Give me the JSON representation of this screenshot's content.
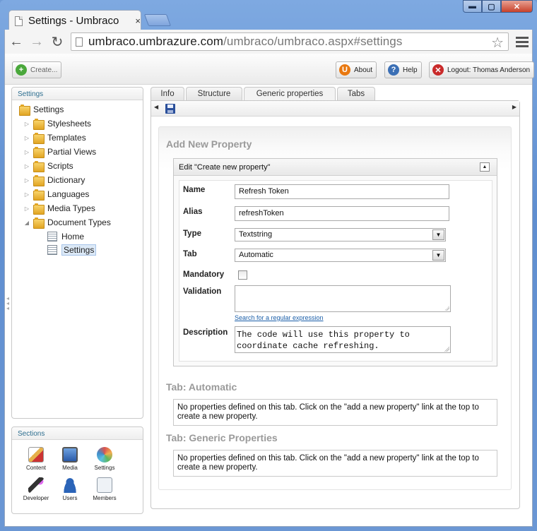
{
  "browser": {
    "tab_title": "Settings - Umbraco",
    "tab_close": "×",
    "url_host": "umbraco.umbrazure.com",
    "url_path": "/umbraco/umbraco.aspx#settings",
    "window_buttons": {
      "minimize": "▬",
      "maximize": "▢",
      "close": "✕"
    }
  },
  "toolbar": {
    "create_label": "Create...",
    "about_label": "About",
    "help_label": "Help",
    "logout_label": "Logout: Thomas Anderson"
  },
  "tree": {
    "title": "Settings",
    "root": "Settings",
    "items": [
      {
        "label": "Stylesheets"
      },
      {
        "label": "Templates"
      },
      {
        "label": "Partial Views"
      },
      {
        "label": "Scripts"
      },
      {
        "label": "Dictionary"
      },
      {
        "label": "Languages"
      },
      {
        "label": "Media Types"
      },
      {
        "label": "Document Types"
      }
    ],
    "children": [
      {
        "label": "Home"
      },
      {
        "label": "Settings"
      }
    ]
  },
  "sections": {
    "title": "Sections",
    "items": [
      {
        "label": "Content",
        "color": "#e6b04a"
      },
      {
        "label": "Media",
        "color": "#3b6fb5"
      },
      {
        "label": "Settings",
        "color": "#d9534f"
      },
      {
        "label": "Developer",
        "color": "#7b3fa0"
      },
      {
        "label": "Users",
        "color": "#2b64b8"
      },
      {
        "label": "Members",
        "color": "#8f9aa6"
      }
    ]
  },
  "tabs": [
    {
      "label": "Info"
    },
    {
      "label": "Structure"
    },
    {
      "label": "Generic properties",
      "active": true
    },
    {
      "label": "Tabs"
    }
  ],
  "property_editor": {
    "heading": "Add New Property",
    "edit_title": "Edit \"Create new property\"",
    "collapse_symbol": "▲",
    "fields": {
      "name_label": "Name",
      "name_value": "Refresh Token",
      "alias_label": "Alias",
      "alias_value": "refreshToken",
      "type_label": "Type",
      "type_value": "Textstring",
      "tab_label": "Tab",
      "tab_value": "Automatic",
      "mandatory_label": "Mandatory",
      "mandatory_checked": false,
      "validation_label": "Validation",
      "validation_value": "",
      "regex_link": "Search for a regular expression",
      "description_label": "Description",
      "description_value": "The code will use this property to coordinate cache refreshing."
    }
  },
  "tab_sections": [
    {
      "heading": "Tab: Automatic",
      "message": "No properties defined on this tab. Click on the \"add a new property\" link at the top to create a new property."
    },
    {
      "heading": "Tab: Generic Properties",
      "message": "No properties defined on this tab. Click on the \"add a new property\" link at the top to create a new property."
    }
  ]
}
